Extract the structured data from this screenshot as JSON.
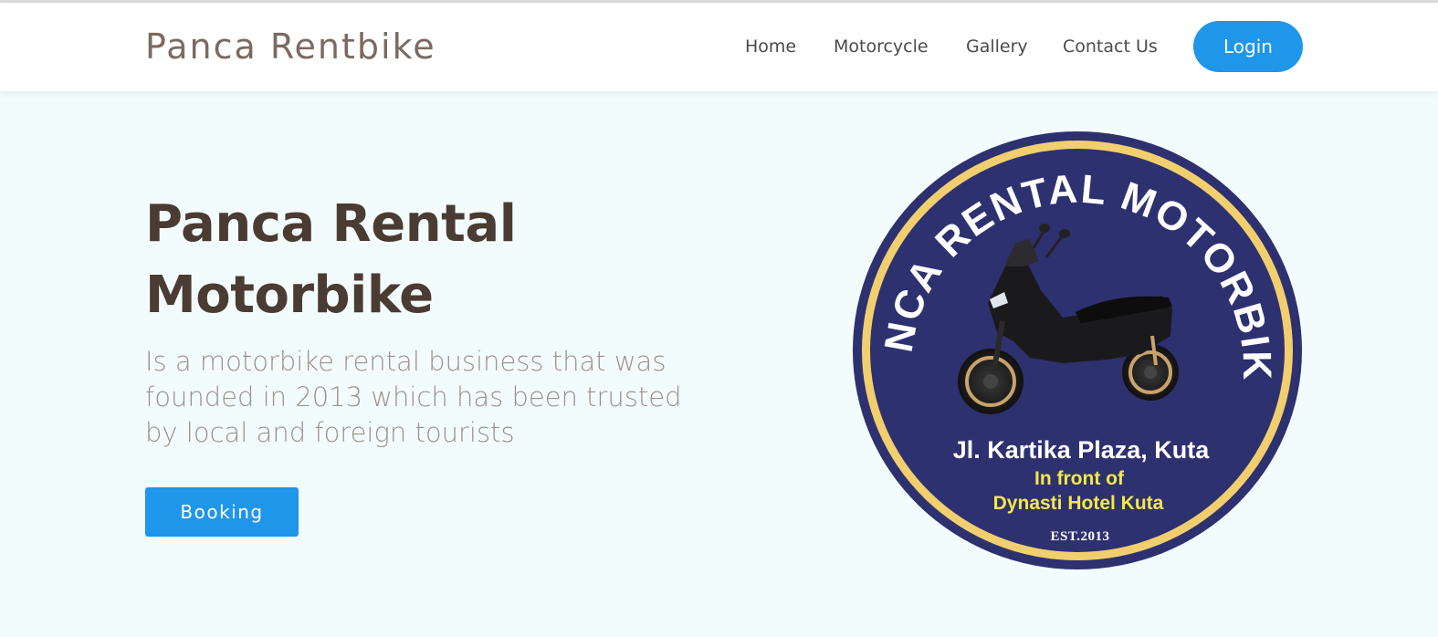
{
  "navbar": {
    "brand": "Panca Rentbike",
    "links": [
      "Home",
      "Motorcycle",
      "Gallery",
      "Contact Us"
    ],
    "login_label": "Login"
  },
  "hero": {
    "title_line1": "Panca Rental",
    "title_line2": "Motorbike",
    "description": "Is a motorbike rental business that was founded in 2013 which has been trusted by local and foreign tourists",
    "booking_label": "Booking"
  },
  "logo": {
    "arc_text": "PANCA RENTAL MOTORBIKE",
    "address": "Jl. Kartika Plaza, Kuta",
    "location_line1": "In front of",
    "location_line2": "Dynasti Hotel Kuta",
    "established": "EST.2013"
  },
  "colors": {
    "accent": "#1e96ea",
    "logo_navy": "#2e3170",
    "logo_gold": "#f2cf6e",
    "logo_yellow_text": "#f4e84a",
    "hero_bg": "#f3fcfd",
    "title_color": "#4a3b33"
  }
}
